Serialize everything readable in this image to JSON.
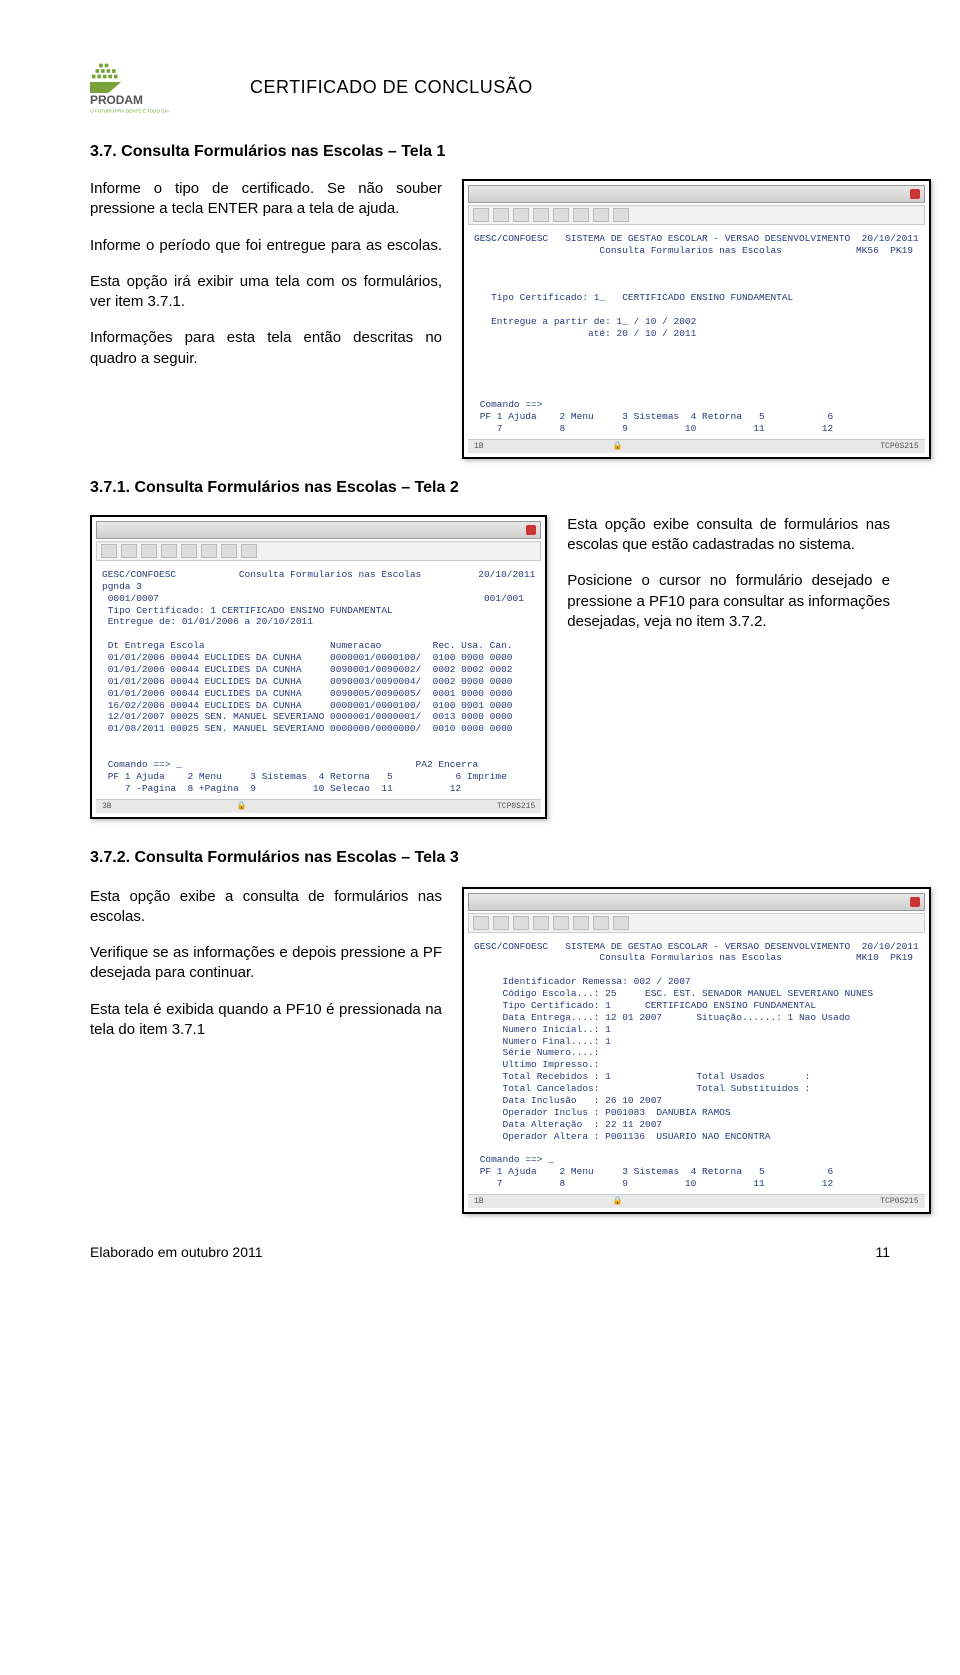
{
  "header": {
    "page_title": "CERTIFICADO DE CONCLUSÃO",
    "logo_line1": "PRODAM",
    "logo_line2": "O FUTURO PRA GENTE É TODO DIA"
  },
  "s37": {
    "heading": "3.7. Consulta Formulários nas Escolas – Tela 1",
    "p1": "Informe o tipo de certificado. Se não souber pressione a tecla ENTER para a tela de ajuda.",
    "p2": "Informe o período que foi entregue para as escolas.",
    "p3": "Esta opção irá exibir uma tela com os formulários, ver  item 3.7.1.",
    "p4": "Informações para esta tela então descritas no quadro a seguir.",
    "term": "GESC/CONFOESC   SISTEMA DE GESTAO ESCOLAR - VERSAO DESENVOLVIMENTO  20/10/2011\n                      Consulta Formularios nas Escolas             MK56  PK19\n\n\n\n   Tipo Certificado: 1_   CERTIFICADO ENSINO FUNDAMENTAL\n\n   Entregue a partir de: 1_ / 10 / 2002\n                    até: 20 / 10 / 2011\n\n\n\n\n\n Comando ==>\n PF 1 Ajuda    2 Menu     3 Sistemas  4 Retorna   5           6\n    7          8          9          10          11          12",
    "footer_right": "TCP0S215"
  },
  "s371": {
    "heading": "3.7.1. Consulta Formulários nas Escolas – Tela 2",
    "p1": "Esta opção exibe consulta de formulários nas escolas que estão cadastradas no sistema.",
    "p2": "Posicione o cursor no formulário desejado e pressione a PF10 para consultar as informações desejadas, veja no item 3.7.2.",
    "term": "GESC/CONFOESC           Consulta Formularios nas Escolas          20/10/2011\npgnda 3\n 0001/0007                                                         001/001\n Tipo Certificado: 1 CERTIFICADO ENSINO FUNDAMENTAL\n Entregue de: 01/01/2006 a 20/10/2011\n\n Dt Entrega Escola                      Numeracao         Rec. Usa. Can.\n 01/01/2006 00044 EUCLIDES DA CUNHA     0000001/0000100/  0100 0000 0000\n 01/01/2006 00044 EUCLIDES DA CUNHA     0090001/0090002/  0002 0002 0002\n 01/01/2006 00044 EUCLIDES DA CUNHA     0090003/0090004/  0002 0000 0000\n 01/01/2006 00044 EUCLIDES DA CUNHA     0090005/0090005/  0001 0000 0000\n 16/02/2006 00044 EUCLIDES DA CUNHA     0000001/0000100/  0100 0001 0000\n 12/01/2007 00025 SEN. MANUEL SEVERIANO 0000001/0000001/  0013 0000 0000\n 01/08/2011 00025 SEN. MANUEL SEVERIANO 0000000/0000000/  0010 0000 0000\n\n\n Comando ==> _                                         PA2 Encerra\n PF 1 Ajuda    2 Menu     3 Sistemas  4 Retorna   5           6 Imprime\n    7 -Pagina  8 +Pagina  9          10 Selecao  11          12",
    "footer_right": "TCP0S215"
  },
  "s372": {
    "heading": "3.7.2. Consulta Formulários nas Escolas – Tela 3",
    "p1": "Esta opção exibe a consulta de formulários nas escolas.",
    "p2": "Verifique se as informações e depois pressione a PF desejada para continuar.",
    "p3": "Esta tela é exibida quando a PF10 é pressionada na tela do item 3.7.1",
    "term": "GESC/CONFOESC   SISTEMA DE GESTAO ESCOLAR - VERSAO DESENVOLVIMENTO  20/10/2011\n                      Consulta Formularios nas Escolas             MK10  PK19\n\n     Identificador Remessa: 002 / 2007\n     Código Escola...: 25     ESC. EST. SENADOR MANUEL SEVERIANO NUNES\n     Tipo Certificado: 1      CERTIFICADO ENSINO FUNDAMENTAL\n     Data Entrega....: 12 01 2007      Situação......: 1 Nao Usado\n     Numero Inicial..: 1\n     Numero Final....: 1\n     Série Numero....:\n     Ultimo Impresso.:\n     Total Recebidos : 1               Total Usados       :\n     Total Cancelados:                 Total Substituidos :\n     Data Inclusão   : 26 10 2007\n     Operador Inclus : P001083  DANUBIA RAMOS\n     Data Alteração  : 22 11 2007\n     Operador Altera : P001136  USUARIO NAO ENCONTRA\n\n Comando ==> _\n PF 1 Ajuda    2 Menu     3 Sistemas  4 Retorna   5           6\n    7          8          9          10          11          12",
    "footer_right": "TCP0S215"
  },
  "footer": {
    "left": "Elaborado em outubro 2011",
    "pnum": "11"
  }
}
